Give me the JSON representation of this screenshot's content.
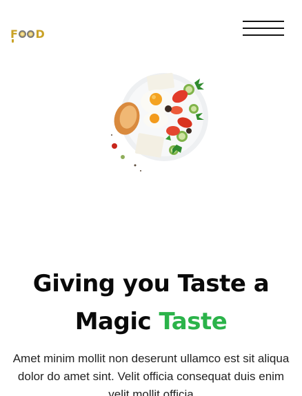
{
  "header": {
    "logo_text": "FOOD",
    "logo_letters": [
      "F",
      "",
      "",
      "D"
    ]
  },
  "hero": {
    "image_icon": "breakfast-plate-image",
    "title_line1": "Giving you Taste a",
    "title_line2_plain": "Magic ",
    "title_line2_accent": "Taste",
    "accent_color": "#2bb34a",
    "body_text": "Amet minim mollit non deserunt ullamco est sit aliqua dolor do amet sint. Velit officia consequat duis enim velit mollit officia"
  },
  "menu": {
    "icon": "hamburger-menu-icon"
  }
}
